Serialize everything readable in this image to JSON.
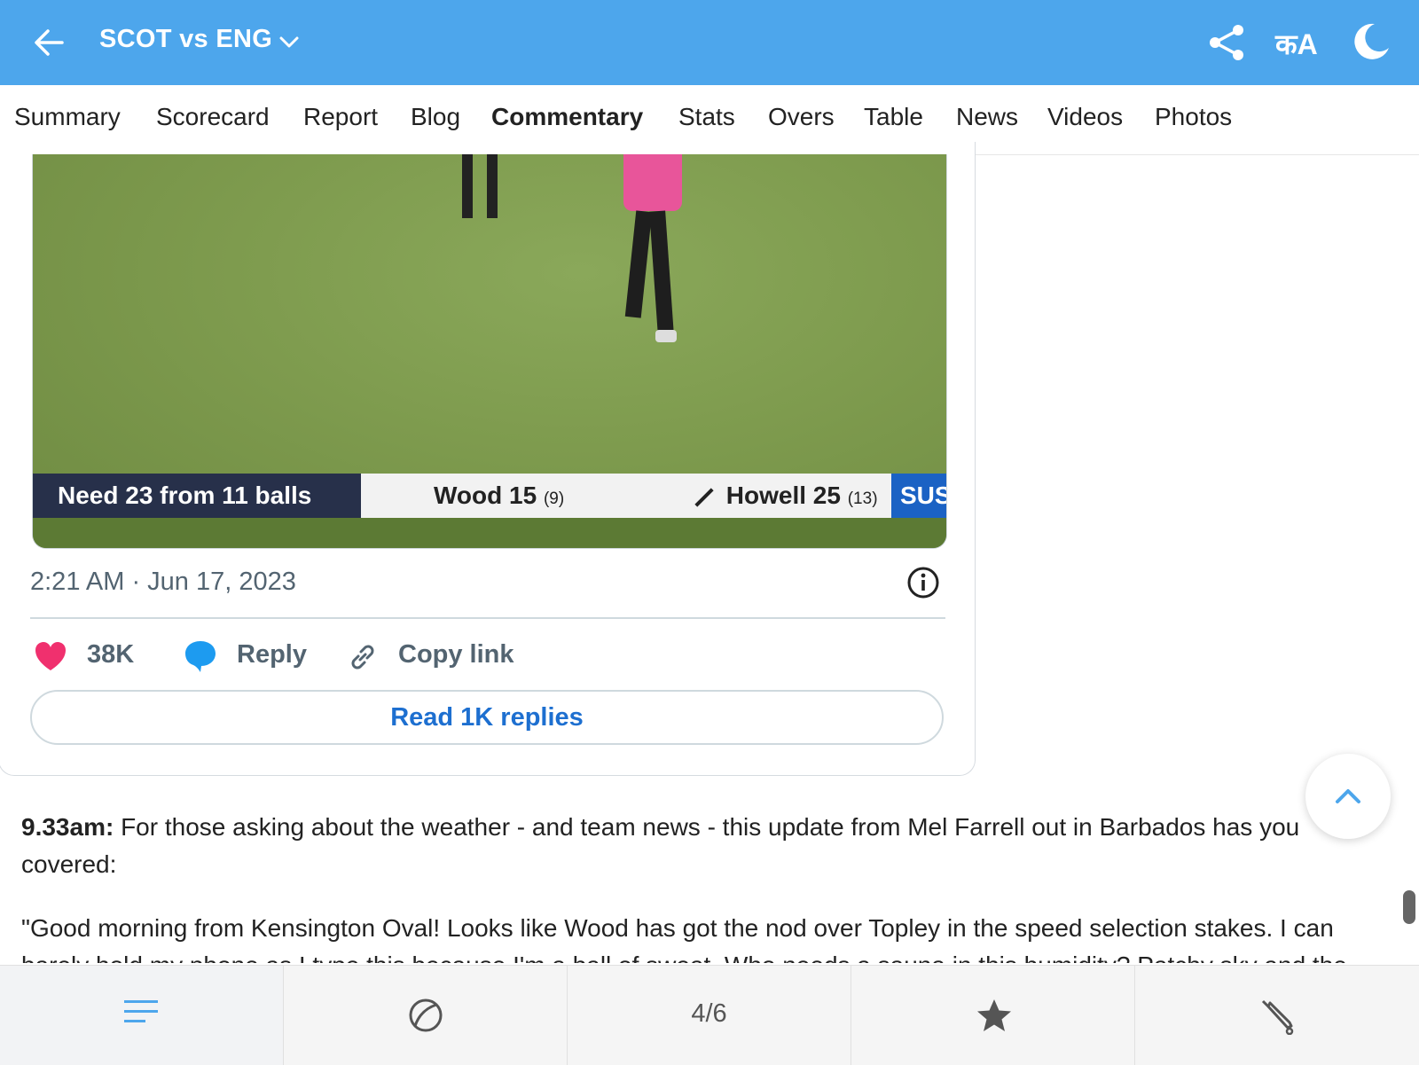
{
  "header": {
    "title": "SCOT vs ENG",
    "lang_label": "कA",
    "bg_color": "#4da6ec"
  },
  "tabs": [
    {
      "label": "Summary"
    },
    {
      "label": "Scorecard"
    },
    {
      "label": "Report"
    },
    {
      "label": "Blog"
    },
    {
      "label": "Commentary",
      "active": true
    },
    {
      "label": "Stats"
    },
    {
      "label": "Overs"
    },
    {
      "label": "Table"
    },
    {
      "label": "News"
    },
    {
      "label": "Videos"
    },
    {
      "label": "Photos"
    }
  ],
  "tweet": {
    "video": {
      "need_text": "Need 23 from 11 balls",
      "batter1": "Wood 15",
      "batter1_balls": "(9)",
      "batter2": "Howell 25",
      "batter2_balls": "(13)",
      "team_tag": "SUS"
    },
    "timestamp": "2:21 AM · Jun 17, 2023",
    "likes": "38K",
    "reply_label": "Reply",
    "copy_label": "Copy link",
    "read_replies_label": "Read 1K replies",
    "heart_color": "#f0306e",
    "accent_color": "#1d6fd0"
  },
  "article": {
    "p1_time": "9.33am:",
    "p1_text": " For those asking about the weather - and team news - this update from Mel Farrell out in Barbados has you covered:",
    "p2_text": "\"Good morning from Kensington Oval! Looks like Wood has got the nod over Topley in the speed selection stakes. I can barely hold my phone as I type this because I'm a ball of sweat. Who needs a sauna in this humidity? Patchy sky and the"
  },
  "bottom_nav": {
    "page_indicator": "4/6",
    "icons": [
      "list-icon",
      "cricket-ball-icon",
      "star-icon",
      "cricket-bat-icon"
    ]
  }
}
